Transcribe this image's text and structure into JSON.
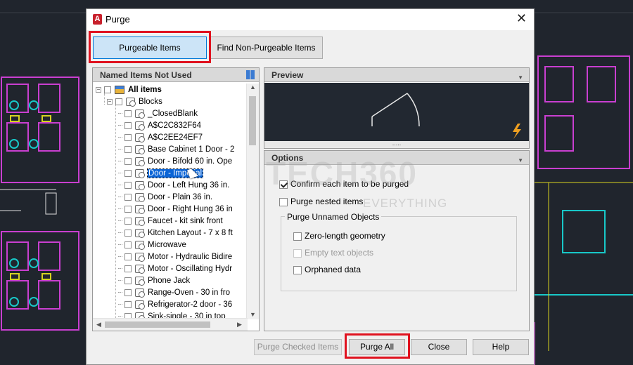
{
  "window": {
    "title": "Purge",
    "close_glyph": "✕"
  },
  "tabs": {
    "purgeable": "Purgeable Items",
    "non_purgeable": "Find Non-Purgeable Items"
  },
  "left_panel": {
    "header": "Named Items Not Used",
    "root_label": "All items",
    "group_label": "Blocks",
    "items": [
      "_ClosedBlank",
      "A$C2C832F64",
      "A$C2EE24EF7",
      "Base Cabinet 1 Door - 2",
      "Door - Bifold 60 in. Ope",
      "Door - Imperial",
      "Door - Left Hung 36 in.",
      "Door - Plain 36 in.",
      "Door - Right Hung 36 in",
      "Faucet - kit sink front",
      "Kitchen Layout - 7 x 8 ft",
      "Microwave",
      "Motor - Hydraulic Bidire",
      "Motor - Oscillating Hydr",
      "Phone Jack",
      "Range-Oven - 30 in fro",
      "Refrigerator-2 door - 36",
      "Sink-single - 30 in top"
    ],
    "highlighted_item": "Door - Imperial"
  },
  "preview": {
    "header": "Preview"
  },
  "options": {
    "header": "Options",
    "confirm_each": {
      "label": "Confirm each item to be purged",
      "checked": true
    },
    "purge_nested": {
      "label": "Purge nested items",
      "checked": false
    },
    "unnamed_group": "Purge Unnamed Objects",
    "zero_length": {
      "label": "Zero-length geometry",
      "checked": false
    },
    "empty_text": {
      "label": "Empty text objects",
      "checked": false,
      "enabled": false
    },
    "orphaned": {
      "label": "Orphaned data",
      "checked": false
    }
  },
  "footer": {
    "purge_checked": "Purge Checked Items",
    "purge_all": "Purge All",
    "close": "Close",
    "help": "Help"
  },
  "watermark": {
    "main": "TECH360",
    "sub": "EVERYTHING"
  },
  "colors": {
    "highlight": "#0a64d6",
    "callout": "#e0121f",
    "cad_bg": "#20252d"
  },
  "icons": [
    "autocad-app-icon",
    "close-icon",
    "sort-icon",
    "collapse-icon",
    "lightning-icon",
    "block-icon"
  ]
}
